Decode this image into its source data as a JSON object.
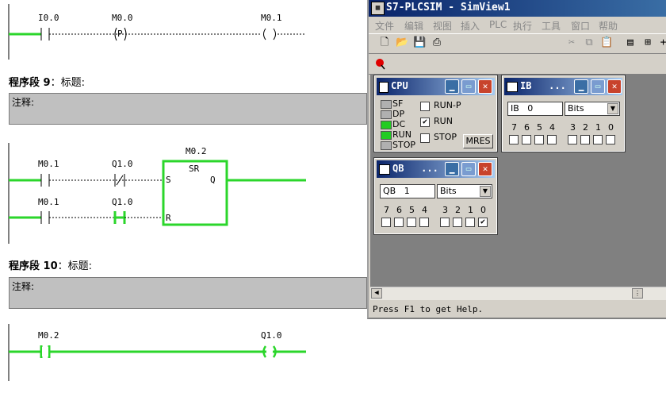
{
  "ladder": {
    "net8": {
      "c1": "I0.0",
      "c2": "M0.0",
      "c2_sym": "P",
      "coil": "M0.1"
    },
    "seg9": {
      "label": "程序段",
      "num": "9",
      "sub": "：标题:",
      "comment": "注释:"
    },
    "net9": {
      "row1_c1": "M0.1",
      "row1_c2": "Q1.0",
      "row2_c1": "M0.1",
      "row2_c2": "Q1.0",
      "block_var": "M0.2",
      "block_name": "SR",
      "pin_s": "S",
      "pin_r": "R",
      "pin_q": "Q"
    },
    "seg10": {
      "label": "程序段",
      "num": "10",
      "sub": "：标题:",
      "comment": "注释:"
    },
    "net10": {
      "c1": "M0.2",
      "coil": "Q1.0"
    }
  },
  "plcsim": {
    "title": "S7-PLCSIM - SimView1",
    "menu": [
      "文件",
      "编辑",
      "视图",
      "插入",
      "PLC",
      "执行",
      "工具",
      "窗口",
      "帮助"
    ],
    "status": "Press F1 to get Help.",
    "cpu": {
      "title": "CPU",
      "leds": [
        {
          "label": "SF",
          "color": "#b0b0b0"
        },
        {
          "label": "DP",
          "color": "#b0b0b0"
        },
        {
          "label": "DC",
          "color": "#22cc22"
        },
        {
          "label": "RUN",
          "color": "#22cc22"
        },
        {
          "label": "STOP",
          "color": "#b0b0b0"
        }
      ],
      "modes": [
        {
          "label": "RUN-P",
          "checked": false
        },
        {
          "label": "RUN",
          "checked": true
        },
        {
          "label": "STOP",
          "checked": false
        }
      ],
      "mres": "MRES"
    },
    "ib": {
      "title": "IB   ...",
      "area": "IB",
      "addr": "0",
      "format": "Bits",
      "bits": [
        "7",
        "6",
        "5",
        "4",
        "3",
        "2",
        "1",
        "0"
      ],
      "checked": [
        false,
        false,
        false,
        false,
        false,
        false,
        false,
        false
      ]
    },
    "qb": {
      "title": "QB   ...",
      "area": "QB",
      "addr": "1",
      "format": "Bits",
      "bits": [
        "7",
        "6",
        "5",
        "4",
        "3",
        "2",
        "1",
        "0"
      ],
      "checked": [
        false,
        false,
        false,
        false,
        false,
        false,
        false,
        true
      ]
    }
  },
  "icons": [
    "new-icon",
    "open-icon",
    "save-icon",
    "print-icon",
    "cut-icon",
    "copy-icon",
    "paste-icon",
    "cascade-icon",
    "tile-icon",
    "run-marker-icon",
    "pushpin-icon"
  ]
}
